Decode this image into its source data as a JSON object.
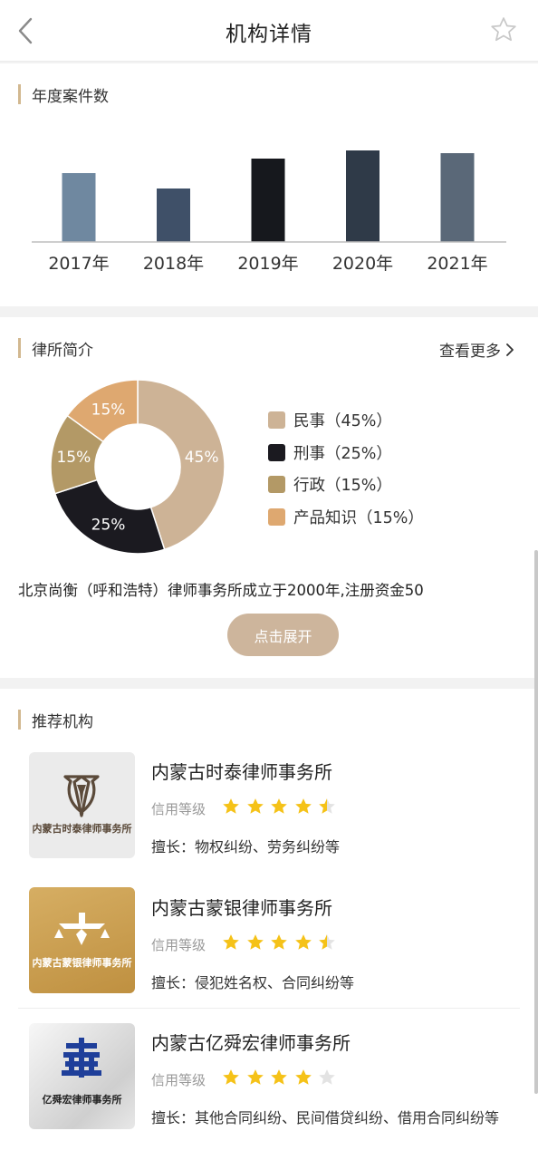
{
  "nav": {
    "title": "机构详情",
    "back_icon": "chevron-left-icon",
    "favorite_icon": "star-outline-icon"
  },
  "annual_cases": {
    "section_title": "年度案件数",
    "chart_data": {
      "type": "bar",
      "title": "",
      "categories": [
        "2017年",
        "2018年",
        "2019年",
        "2020年",
        "2021年"
      ],
      "values": [
        76,
        59,
        92,
        101,
        98
      ],
      "colors": [
        "#6f88a0",
        "#3f5068",
        "#16181d",
        "#2f3a48",
        "#5a6878"
      ],
      "ylim": [
        0,
        110
      ],
      "grid": false
    }
  },
  "firm_intro": {
    "section_title": "律所简介",
    "more_label": "查看更多",
    "chart_data": {
      "type": "pie",
      "title": "",
      "categories": [
        "民事",
        "刑事",
        "行政",
        "产品知识"
      ],
      "values": [
        45,
        25,
        15,
        15
      ],
      "slice_labels": [
        "45%",
        "25%",
        "15%",
        "15%"
      ],
      "colors": [
        "#cdb396",
        "#1b1a20",
        "#b39966",
        "#dea870"
      ],
      "legend": [
        "民事（45%）",
        "刑事（25%）",
        "行政（15%）",
        "产品知识（15%）"
      ],
      "legend_position": "right",
      "donut": true
    },
    "description": "北京尚衡（呼和浩特）律师事务所成立于2000年,注册资金50",
    "expand_label": "点击展开"
  },
  "recommended": {
    "section_title": "推荐机构",
    "credit_label": "信用等级",
    "firms": [
      {
        "name": "内蒙古时泰律师事务所",
        "logo_text": "内蒙古时泰律师事务所",
        "rating": 4.5,
        "specialty": "擅长：物权纠纷、劳务纠纷等"
      },
      {
        "name": "内蒙古蒙银律师事务所",
        "logo_text": "内蒙古蒙银律师事务所",
        "rating": 4.5,
        "specialty": "擅长：侵犯姓名权、合同纠纷等"
      },
      {
        "name": "内蒙古亿舜宏律师事务所",
        "logo_text": "亿舜宏律师事务所",
        "rating": 4,
        "specialty": "擅长：其他合同纠纷、民间借贷纠纷、借用合同纠纷等"
      }
    ]
  },
  "colors": {
    "accent": "#d2b890",
    "star": "#f5c218",
    "star_empty": "#e3e3e3",
    "button": "#cdb59c"
  }
}
